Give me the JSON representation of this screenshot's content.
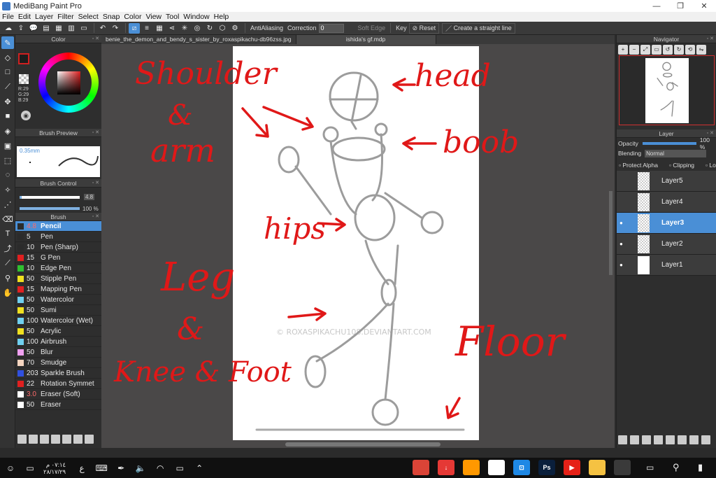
{
  "window": {
    "title": "MediBang Paint Pro",
    "min": "—",
    "max": "❐",
    "close": "✕"
  },
  "menu": [
    "File",
    "Edit",
    "Layer",
    "Filter",
    "Select",
    "Snap",
    "Color",
    "View",
    "Tool",
    "Window",
    "Help"
  ],
  "toolbar": {
    "antialiasing_label": "AntiAliasing",
    "correction_label": "Correction",
    "correction_value": "0",
    "soft_edge_label": "Soft Edge",
    "key_label": "Key",
    "reset_label": "Reset",
    "straight_line_label": "Create a straight line"
  },
  "color_panel": {
    "title": "Color",
    "rgb": {
      "r": "R:29",
      "g": "G:29",
      "b": "B:29"
    },
    "fg_color": "#1d1d1d"
  },
  "brush_preview": {
    "title": "Brush Preview",
    "size_label": "0.35mm"
  },
  "brush_control": {
    "title": "Brush Control",
    "size_value": "4.8",
    "opacity_value": "100 %"
  },
  "brush_panel": {
    "title": "Brush",
    "items": [
      {
        "size": "4.8",
        "name": "Pencil",
        "color": "#2b2b2b",
        "size_red": true,
        "active": true
      },
      {
        "size": "5",
        "name": "Pen",
        "color": "#2b2b2b"
      },
      {
        "size": "10",
        "name": "Pen (Sharp)",
        "color": "#2b2b2b"
      },
      {
        "size": "15",
        "name": "G Pen",
        "color": "#e02020"
      },
      {
        "size": "10",
        "name": "Edge Pen",
        "color": "#30c030"
      },
      {
        "size": "50",
        "name": "Stipple Pen",
        "color": "#f0e020"
      },
      {
        "size": "15",
        "name": "Mapping Pen",
        "color": "#e02020"
      },
      {
        "size": "50",
        "name": "Watercolor",
        "color": "#70d0f0"
      },
      {
        "size": "50",
        "name": "Sumi",
        "color": "#f0e020"
      },
      {
        "size": "100",
        "name": "Watercolor (Wet)",
        "color": "#70d0f0"
      },
      {
        "size": "50",
        "name": "Acrylic",
        "color": "#f0e020"
      },
      {
        "size": "100",
        "name": "Airbrush",
        "color": "#70d0f0"
      },
      {
        "size": "50",
        "name": "Blur",
        "color": "#f0a0f0"
      },
      {
        "size": "70",
        "name": "Smudge",
        "color": "#f5d5c0"
      },
      {
        "size": "203",
        "name": "Sparkle Brush",
        "color": "#3050e0"
      },
      {
        "size": "22",
        "name": "Rotation Symmet",
        "color": "#e02020"
      },
      {
        "size": "3.0",
        "name": "Eraser (Soft)",
        "color": "#ffffff",
        "size_red": true
      },
      {
        "size": "50",
        "name": "Eraser",
        "color": "#ffffff"
      }
    ]
  },
  "documents": {
    "tab1": "benie_the_demon_and_bendy_s_sister_by_roxaspikachu-db96zss.jpg",
    "tab2": "ishida's gf.mdp"
  },
  "canvas": {
    "annotations": [
      "Shoulder",
      "&",
      "arm",
      "head",
      "boob",
      "hips",
      "Leg",
      "&",
      "Knee & Foot",
      "Floor"
    ],
    "watermark": "© ROXASPIKACHU108.DEVIANTART.COM"
  },
  "navigator": {
    "title": "Navigator"
  },
  "layer_panel": {
    "title": "Layer",
    "opacity_label": "Opacity",
    "opacity_value": "100 %",
    "blending_label": "Blending",
    "blending_value": "Normal",
    "protect_alpha": "Protect Alpha",
    "clipping": "Clipping",
    "lock": "Lock",
    "layers": [
      {
        "name": "Layer5",
        "visible": false,
        "active": false,
        "transparent": true
      },
      {
        "name": "Layer4",
        "visible": false,
        "active": false,
        "transparent": true
      },
      {
        "name": "Layer3",
        "visible": true,
        "active": true,
        "transparent": true
      },
      {
        "name": "Layer2",
        "visible": true,
        "active": false,
        "transparent": true
      },
      {
        "name": "Layer1",
        "visible": true,
        "active": false,
        "transparent": false
      }
    ]
  },
  "taskbar": {
    "clock_time": "٠٧:١٤ م",
    "clock_date": "٢٨/١٧/٢٩",
    "lang": "ع",
    "apps": [
      {
        "name": "chrome-icon",
        "color": "#db4437",
        "label": ""
      },
      {
        "name": "download-icon",
        "color": "#e53935",
        "label": "↓"
      },
      {
        "name": "app-icon",
        "color": "#ff9800",
        "label": ""
      },
      {
        "name": "medibang-icon",
        "color": "#ffffff",
        "label": ""
      },
      {
        "name": "screen-icon",
        "color": "#1e88e5",
        "label": "⊡"
      },
      {
        "name": "photoshop-icon",
        "color": "#0a1f3b",
        "label": "Ps"
      },
      {
        "name": "youtube-icon",
        "color": "#e62117",
        "label": "▶"
      },
      {
        "name": "explorer-icon",
        "color": "#f5c242",
        "label": ""
      },
      {
        "name": "store-icon",
        "color": "#3a3a3a",
        "label": ""
      }
    ]
  }
}
